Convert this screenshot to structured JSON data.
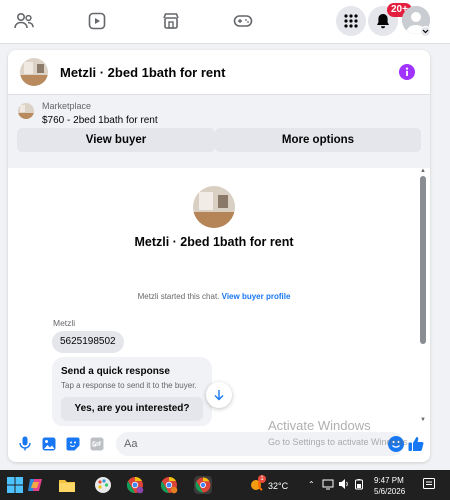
{
  "nav": {
    "notification_count": "20+"
  },
  "chat": {
    "header_title": "Metzli · 2bed 1bath for rent",
    "listing": {
      "category": "Marketplace",
      "price_title": "$760 - 2bed 1bath for rent"
    },
    "buttons": {
      "view_buyer": "View buyer",
      "more_options": "More options"
    },
    "conversation": {
      "title": "Metzli · 2bed 1bath for rent",
      "started_text": "Metzli started this chat.",
      "view_profile_link": "View buyer profile",
      "sender_name": "Metzli",
      "message": "5625198502",
      "quick_response_title": "Send a quick response",
      "quick_response_subtitle": "Tap a response to send it to the buyer.",
      "quick_response_option": "Yes, are you interested?"
    },
    "composer": {
      "placeholder": "Aa"
    }
  },
  "watermark": {
    "line1": "Activate Windows",
    "line2": "Go to Settings to activate Windows."
  },
  "taskbar": {
    "temperature": "32°C",
    "weather_badge": "1",
    "time": "9:47 PM",
    "date": "5/6/2026"
  },
  "colors": {
    "accent": "#1877f2",
    "info_purple": "#a033ff",
    "badge_red": "#e41e3f"
  }
}
